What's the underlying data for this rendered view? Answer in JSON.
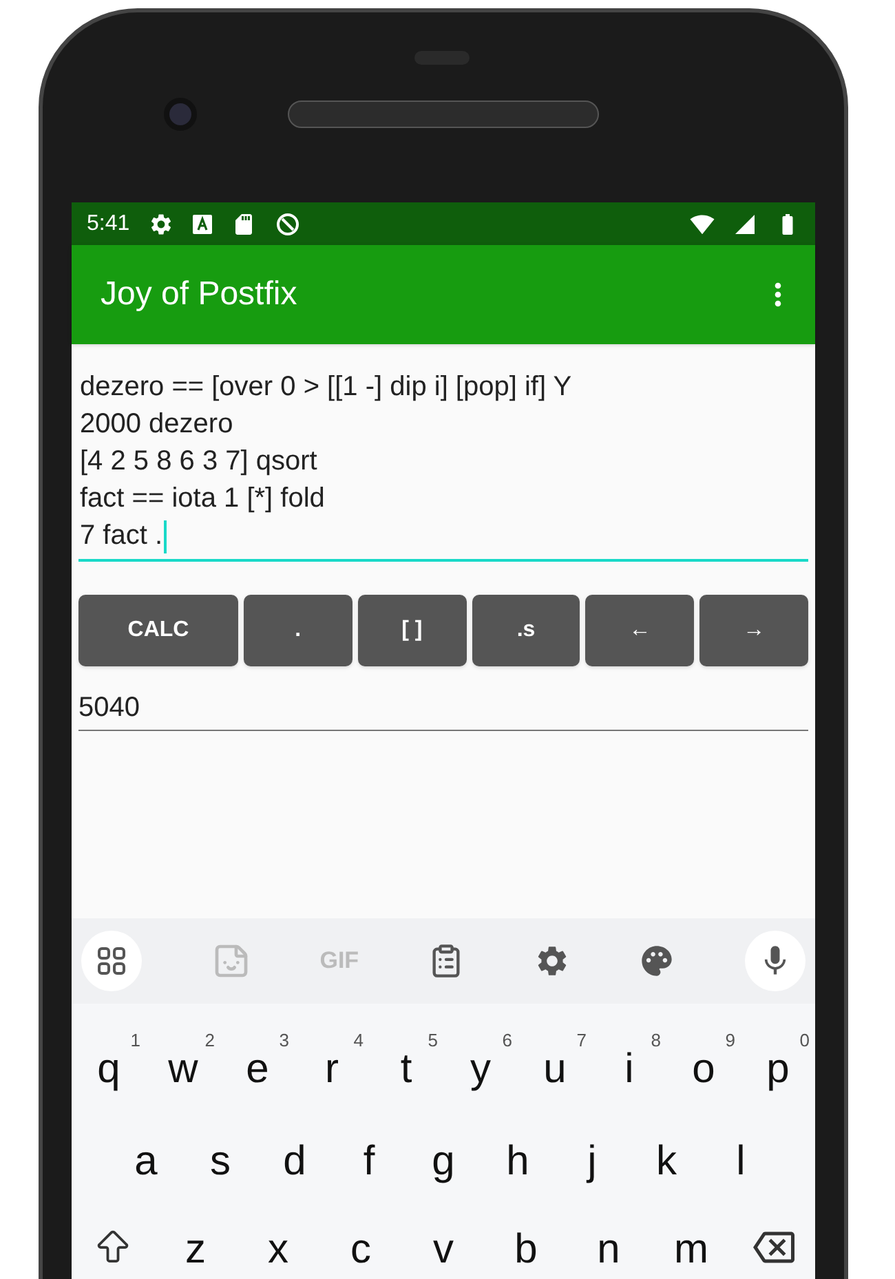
{
  "status_bar": {
    "time": "5:41"
  },
  "app_bar": {
    "title": "Joy of Postfix"
  },
  "editor": {
    "focused": true,
    "lines": [
      "dezero == [over 0 > [[1 -] dip i] [pop] if] Y",
      "2000 dezero",
      "[4 2 5 8 6 3 7] qsort",
      "fact == iota 1 [*] fold",
      "7 fact ."
    ]
  },
  "buttons": [
    "CALC",
    ".",
    "[ ]",
    ".s",
    "←",
    "→"
  ],
  "output": {
    "value": "5040"
  },
  "keyboard": {
    "gif_label": "GIF",
    "rows": [
      [
        {
          "label": "q",
          "hint": "1"
        },
        {
          "label": "w",
          "hint": "2"
        },
        {
          "label": "e",
          "hint": "3"
        },
        {
          "label": "r",
          "hint": "4"
        },
        {
          "label": "t",
          "hint": "5"
        },
        {
          "label": "y",
          "hint": "6"
        },
        {
          "label": "u",
          "hint": "7"
        },
        {
          "label": "i",
          "hint": "8"
        },
        {
          "label": "o",
          "hint": "9"
        },
        {
          "label": "p",
          "hint": "0"
        }
      ],
      [
        {
          "label": "a"
        },
        {
          "label": "s"
        },
        {
          "label": "d"
        },
        {
          "label": "f"
        },
        {
          "label": "g"
        },
        {
          "label": "h"
        },
        {
          "label": "j"
        },
        {
          "label": "k"
        },
        {
          "label": "l"
        }
      ],
      [
        {
          "kind": "shift"
        },
        {
          "label": "z"
        },
        {
          "label": "x"
        },
        {
          "label": "c"
        },
        {
          "label": "v"
        },
        {
          "label": "b"
        },
        {
          "label": "n"
        },
        {
          "label": "m"
        },
        {
          "kind": "backspace"
        }
      ]
    ]
  }
}
